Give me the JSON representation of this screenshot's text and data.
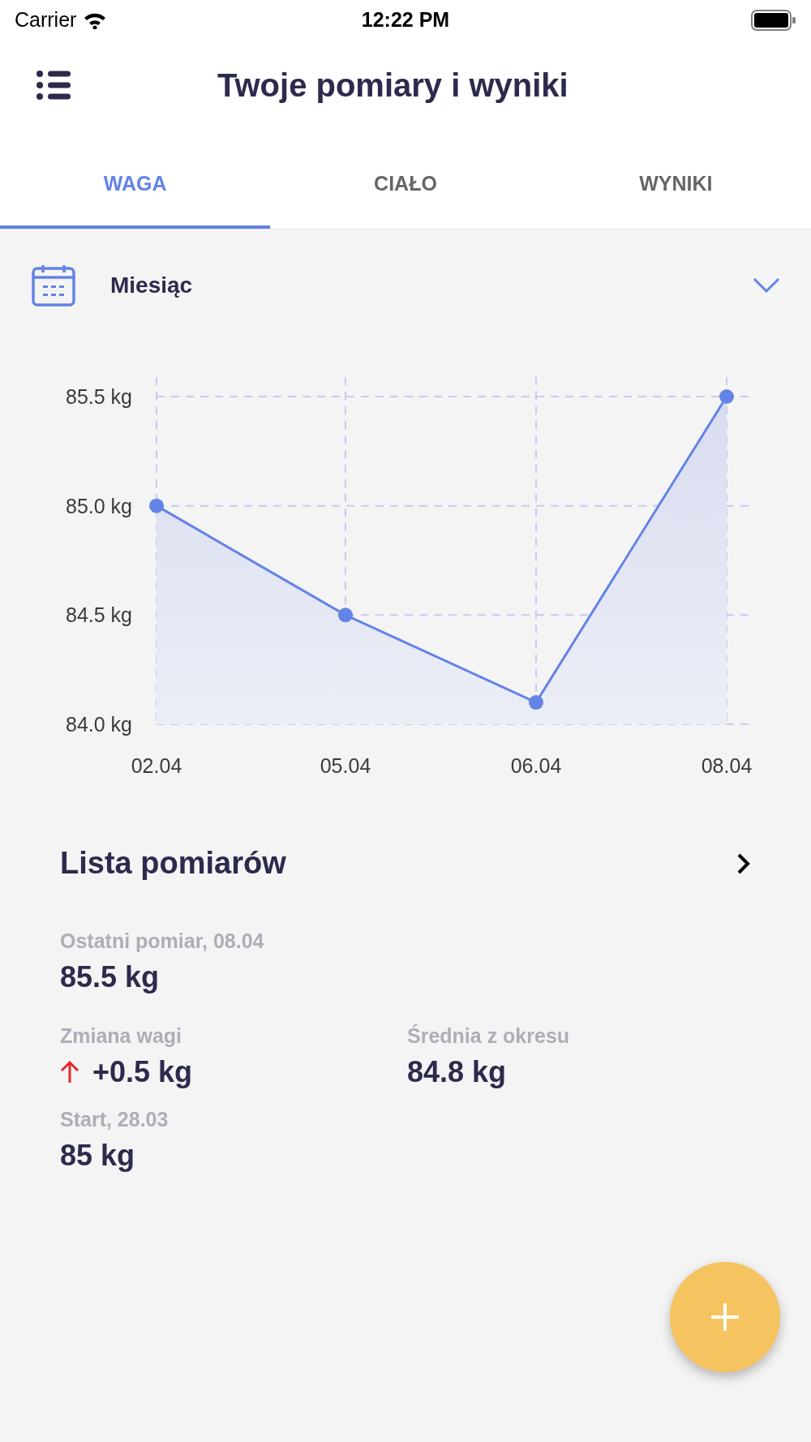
{
  "status_bar": {
    "carrier": "Carrier",
    "time": "12:22 PM"
  },
  "header": {
    "title": "Twoje pomiary i wyniki"
  },
  "tabs": [
    {
      "label": "WAGA",
      "selected": true
    },
    {
      "label": "CIAŁO",
      "selected": false
    },
    {
      "label": "WYNIKI",
      "selected": false
    }
  ],
  "period": {
    "value": "Miesiąc"
  },
  "chart_data": {
    "type": "area",
    "grid": true,
    "categories": [
      "02.04",
      "05.04",
      "06.04",
      "08.04"
    ],
    "series": [
      {
        "color": "#6383e6",
        "marker": "circle",
        "values": [
          85.0,
          84.5,
          84.1,
          85.5
        ]
      }
    ],
    "ylim": [
      84.0,
      85.5
    ],
    "yticks": [
      {
        "value": 85.5,
        "label": "85.5 kg"
      },
      {
        "value": 85.0,
        "label": "85.0 kg"
      },
      {
        "value": 84.5,
        "label": "84.5 kg"
      },
      {
        "value": 84.0,
        "label": "84.0 kg"
      }
    ]
  },
  "list": {
    "title": "Lista pomiarów"
  },
  "stats": [
    {
      "kind": "plain",
      "label": "Ostatni pomiar, 08.04",
      "value": "85.5 kg"
    },
    {
      "kind": "rise",
      "label": "Zmiana wagi",
      "value": "+0.5 kg"
    },
    {
      "kind": "plain",
      "label": "Średnia z okresu",
      "value": "84.8 kg"
    },
    {
      "kind": "plain",
      "label": "Start, 28.03",
      "value": "85 kg"
    }
  ]
}
